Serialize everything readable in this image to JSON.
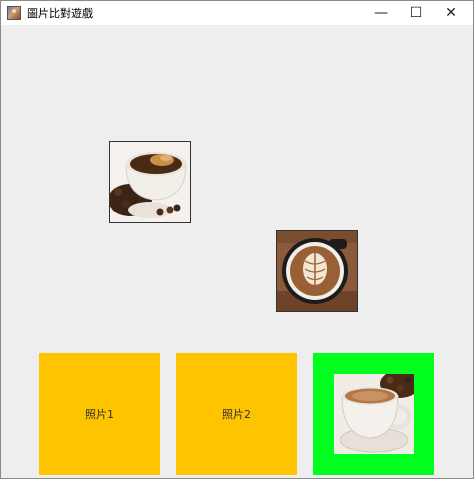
{
  "window": {
    "title": "圖片比對遊戲",
    "controls": {
      "minimize": "—",
      "maximize": "☐",
      "close": "✕"
    }
  },
  "cards": [
    {
      "name": "coffee-cup-beans"
    },
    {
      "name": "latte-art"
    }
  ],
  "slots": [
    {
      "label": "照片1",
      "color": "#ffc400"
    },
    {
      "label": "照片2",
      "color": "#ffc400"
    },
    {
      "label": "",
      "color": "#00ff1e",
      "image": "hot-chocolate-cup"
    }
  ]
}
